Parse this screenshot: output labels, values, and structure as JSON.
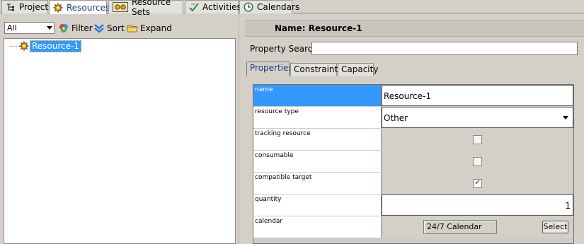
{
  "top_tabs": [
    {
      "label": "Projects",
      "icon": "project-tree-icon"
    },
    {
      "label": "Resources",
      "icon": "gear-resource-icon",
      "active": true
    },
    {
      "label": "Resource Sets",
      "icon": "resource-set-icon"
    },
    {
      "label": "Activities",
      "icon": "activity-check-icon"
    },
    {
      "label": "Calendars",
      "icon": "clock-icon"
    }
  ],
  "left_toolbar": {
    "filter_combo_value": "All",
    "filter_label": "Filter",
    "sort_label": "Sort",
    "expand_label": "Expand"
  },
  "tree": {
    "items": [
      {
        "label": "Resource-1",
        "selected": true
      }
    ]
  },
  "detail": {
    "name_title": "Name: Resource-1",
    "property_search_label": "Property Search:",
    "property_search_value": "",
    "tabs": [
      {
        "label": "Properties",
        "active": true
      },
      {
        "label": "Constraints"
      },
      {
        "label": "Capacity"
      }
    ],
    "properties": {
      "name": {
        "label": "name",
        "value": "Resource-1"
      },
      "resource_type": {
        "label": "resource type",
        "value": "Other"
      },
      "tracking_resource": {
        "label": "tracking resource",
        "checked": false
      },
      "consumable": {
        "label": "consumable",
        "checked": false
      },
      "compatible_target": {
        "label": "compatible target",
        "checked": true,
        "mark": "✓"
      },
      "quantity": {
        "label": "quantity",
        "value": "1"
      },
      "calendar": {
        "label": "calendar",
        "value": "24/7 Calendar",
        "button_label": "Select"
      }
    }
  },
  "colors": {
    "selection": "#3399ff",
    "active_tab_text": "#1b3b8a",
    "chrome": "#d4d0c8"
  }
}
